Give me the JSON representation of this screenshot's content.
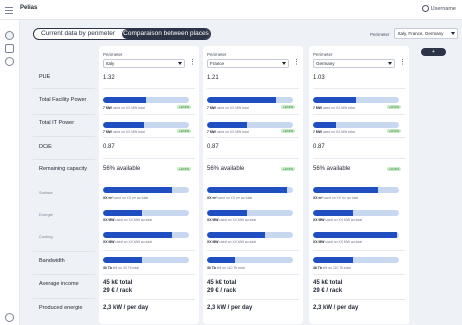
{
  "app": {
    "logo": "Pelias",
    "user": "Username"
  },
  "tabs": [
    {
      "label": "Current data by perimeter",
      "active": false
    },
    {
      "label": "Comparaison between places",
      "active": true
    }
  ],
  "perimeter": {
    "label": "Perimeter",
    "value": "Italy, France, Germany"
  },
  "add_button": "+",
  "rows": {
    "pue": "PUE",
    "total_facility_power": "Total Facility Power",
    "total_it_power": "Total IT Power",
    "dcie": "DCiE",
    "remaining_capacity": "Remaining capacity",
    "surface": "Surface",
    "energie": "Energie",
    "cooling": "Cooling",
    "bandwidth": "Bandwidth",
    "average_income": "Average income",
    "produced_energie": "Produced energie"
  },
  "places": [
    {
      "perimeter_label": "Perimeter",
      "country": "Italy",
      "pue": "1.32",
      "facility_power": {
        "bold": "7 MW",
        "rest": " used on XX MW total",
        "badge": "+12,5%",
        "fraction": 0.5
      },
      "it_power": {
        "bold": "7 MW",
        "rest": " used on XX MW total",
        "badge": "+12,5%",
        "fraction": 0.48
      },
      "dcie": "0.87",
      "remaining": "56% available",
      "remaining_badge": "+12,5%",
      "surface": {
        "bold": "XX m²",
        "rest": " used on XX m² au total",
        "fraction": 0.8
      },
      "energie": {
        "bold": "XX MW",
        "rest": " used on XX MW au total",
        "fraction": 0.45
      },
      "cooling": {
        "bold": "XX MW",
        "rest": " used on XX MW au total",
        "fraction": 0.8
      },
      "bandwidth": {
        "bold": "30 Tb",
        "rest": " left on 33 Tb total",
        "fraction": 0.45
      },
      "income_total": "45 k€ total",
      "income_rack": "29 € / rack",
      "produced": "2,3 kW / per day"
    },
    {
      "perimeter_label": "Perimeter",
      "country": "France",
      "pue": "1.21",
      "facility_power": {
        "bold": "7 MW",
        "rest": " used on XX MW total",
        "badge": "+12,5%",
        "fraction": 0.8
      },
      "it_power": {
        "bold": "7 MW",
        "rest": " used on XX MW total",
        "badge": "+12,5%",
        "fraction": 0.46
      },
      "dcie": "0.87",
      "remaining": "56% available",
      "remaining_badge": "+12,5%",
      "surface": {
        "bold": "XX m²",
        "rest": " used on XX m² au total",
        "fraction": 0.93
      },
      "energie": {
        "bold": "XX MW",
        "rest": " used on XX MW au total",
        "fraction": 0.47
      },
      "cooling": {
        "bold": "XX MW",
        "rest": " used on XX MW au total",
        "fraction": 0.68
      },
      "bandwidth": {
        "bold": "30 Tb",
        "rest": " left on 110 Tb total",
        "fraction": 0.33
      },
      "income_total": "45 k€ total",
      "income_rack": "29 € / rack",
      "produced": "2,3 kW / per day"
    },
    {
      "perimeter_label": "Perimeter",
      "country": "Germany",
      "pue": "1.03",
      "facility_power": {
        "bold": "7 MW",
        "rest": " used on XX MW total",
        "badge": "+12,5%",
        "fraction": 0.5
      },
      "it_power": {
        "bold": "7 MW",
        "rest": " used on XX MW total",
        "badge": "+12,5%",
        "fraction": 0.27
      },
      "dcie": "0.87",
      "remaining": "56% available",
      "remaining_badge": "+12,5%",
      "surface": {
        "bold": "XX m²",
        "rest": " used on XX m² au total",
        "fraction": 0.75
      },
      "energie": {
        "bold": "XX MW",
        "rest": " used on XX MW au total",
        "fraction": 0.47
      },
      "cooling": {
        "bold": "XX MW",
        "rest": " used on XX MW au total",
        "fraction": 0.98
      },
      "bandwidth": {
        "bold": "46 Tb",
        "rest": " left on 110 Tb total",
        "fraction": 0.46
      },
      "income_total": "45 k€ total",
      "income_rack": "29 € / rack",
      "produced": "2,3 kW / per day"
    }
  ]
}
